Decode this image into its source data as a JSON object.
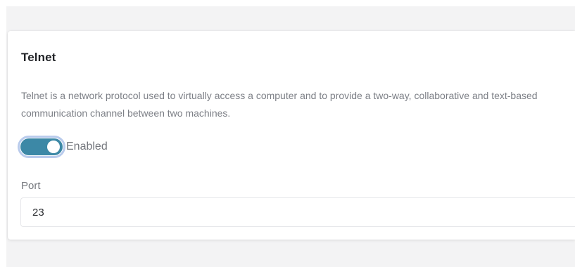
{
  "telnet": {
    "title": "Telnet",
    "description": "Telnet is a network protocol used to virtually access a computer and to provide a two-way, collaborative and text-based communication channel between two machines.",
    "toggle": {
      "label": "Enabled",
      "checked": true
    },
    "port": {
      "label": "Port",
      "value": "23"
    }
  },
  "colors": {
    "toggle_on": "#3c88a6",
    "toggle_focus_ring": "#b9cbec",
    "page_background": "#f3f3f4"
  }
}
